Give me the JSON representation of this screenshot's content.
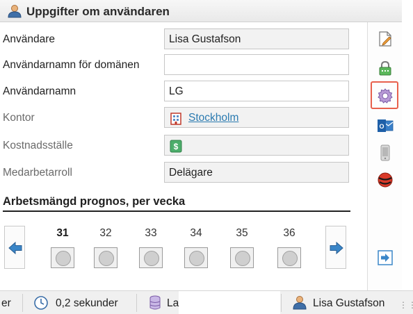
{
  "header": {
    "title": "Uppgifter om användaren",
    "icon": "user-icon"
  },
  "form": {
    "fields": [
      {
        "label": "Användare",
        "value": "Lisa Gustafson"
      },
      {
        "label": "Användarnamn för domänen",
        "value": ""
      },
      {
        "label": "Användarnamn",
        "value": "LG"
      },
      {
        "label": "Kontor",
        "value": "Stockholm",
        "icon": "office-building-icon"
      },
      {
        "label": "Kostnadsställe",
        "value": "",
        "icon": "money-icon"
      },
      {
        "label": "Medarbetarroll",
        "value": "Delägare"
      }
    ]
  },
  "forecast": {
    "title": "Arbetsmängd prognos, per vecka",
    "weeks": [
      "31",
      "32",
      "33",
      "34",
      "35",
      "36"
    ],
    "current_week": "31"
  },
  "toolbar": {
    "buttons": [
      "edit-document-icon",
      "lock-icon",
      "settings-gear-icon",
      "outlook-icon",
      "mobile-phone-icon",
      "ball-icon",
      "exit-arrow-icon"
    ],
    "active": "settings-gear-icon"
  },
  "statusbar": {
    "left_fragment": "er",
    "time_text": "0,2 sekunder",
    "db_fragment": "La",
    "user_name": "Lisa Gustafson"
  },
  "colors": {
    "accent_link": "#2a7ab0",
    "active_border": "#e8604c",
    "arrow_blue": "#3a86c8"
  }
}
